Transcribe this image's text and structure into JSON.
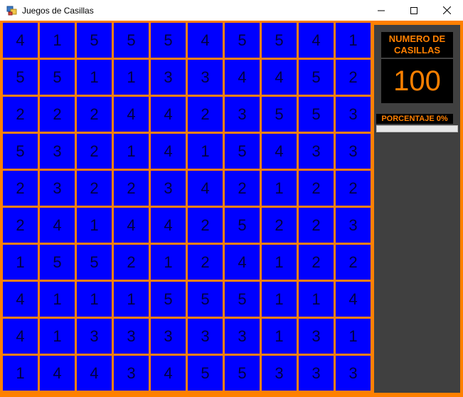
{
  "window": {
    "title": "Juegos de Casillas",
    "minimize_symbol": "—",
    "maximize_symbol": "☐",
    "close_symbol": "✕"
  },
  "board": {
    "rows": [
      [
        4,
        1,
        5,
        5,
        5,
        4,
        5,
        5,
        4,
        1
      ],
      [
        5,
        5,
        1,
        1,
        3,
        3,
        4,
        4,
        5,
        2
      ],
      [
        2,
        2,
        2,
        4,
        4,
        2,
        3,
        5,
        5,
        3
      ],
      [
        5,
        3,
        2,
        1,
        4,
        1,
        5,
        4,
        3,
        3
      ],
      [
        2,
        3,
        2,
        2,
        3,
        4,
        2,
        1,
        2,
        2
      ],
      [
        2,
        4,
        1,
        4,
        4,
        2,
        5,
        2,
        2,
        3
      ],
      [
        1,
        5,
        5,
        2,
        1,
        2,
        4,
        1,
        2,
        2
      ],
      [
        4,
        1,
        1,
        1,
        5,
        5,
        5,
        1,
        1,
        4
      ],
      [
        4,
        1,
        3,
        3,
        3,
        3,
        3,
        1,
        3,
        1
      ],
      [
        1,
        4,
        4,
        3,
        4,
        5,
        5,
        3,
        3,
        3
      ]
    ]
  },
  "sidebar": {
    "count_label": "NUMERO DE CASILLAS",
    "count_value": "100",
    "percent_label": "PORCENTAJE 0%",
    "percent_value": 0
  },
  "colors": {
    "accent": "#ff8000",
    "cell": "#0000ff",
    "panel": "#404040"
  }
}
